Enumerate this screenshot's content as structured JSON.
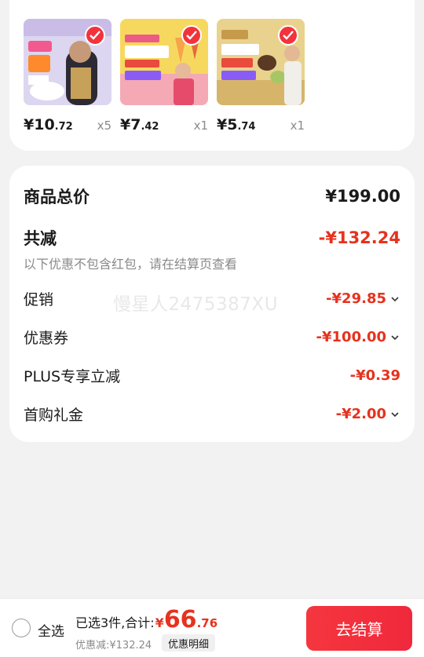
{
  "products": [
    {
      "price_int": "¥10",
      "price_dec": ".72",
      "qty": "x5",
      "img_bg": "#d9d3ef"
    },
    {
      "price_int": "¥7",
      "price_dec": ".42",
      "qty": "x1",
      "img_bg": "#f6d55b"
    },
    {
      "price_int": "¥5",
      "price_dec": ".74",
      "qty": "x1",
      "img_bg": "#e7d08a"
    }
  ],
  "summary": {
    "total_label": "商品总价",
    "total_value": "¥199.00",
    "discount_label": "共减",
    "discount_value": "-¥132.24",
    "note": "以下优惠不包含红包，请在结算页查看",
    "items": [
      {
        "label": "促销",
        "value": "-¥29.85",
        "expandable": true
      },
      {
        "label": "优惠券",
        "value": "-¥100.00",
        "expandable": true
      },
      {
        "label": "PLUS专享立减",
        "value": "-¥0.39",
        "expandable": false
      },
      {
        "label": "首购礼金",
        "value": "-¥2.00",
        "expandable": true
      }
    ],
    "watermark": "慢星人2475387XU"
  },
  "bottom": {
    "select_all": "全选",
    "selected_text": "已选3件,合计:",
    "currency": "¥",
    "sum_int": "66",
    "sum_dec": ".76",
    "saved_text": "优惠减:¥132.24",
    "detail_label": "优惠明细",
    "checkout_label": "去结算"
  },
  "colors": {
    "accent": "#e6321e",
    "button": "#f2333b"
  }
}
